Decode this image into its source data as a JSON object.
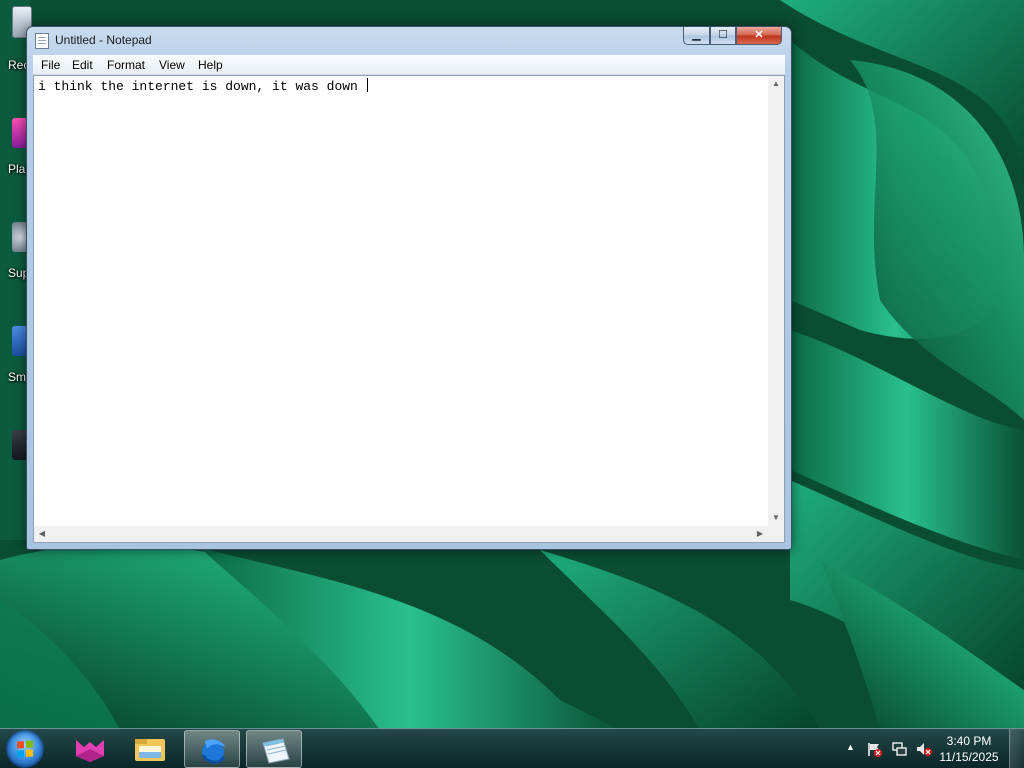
{
  "desktop": {
    "icons": [
      {
        "label": "Rec",
        "icon": "recycle-bin-icon"
      },
      {
        "label": "Pla",
        "icon": "shortcut-icon"
      },
      {
        "label": "Sup",
        "icon": "shortcut-icon"
      },
      {
        "label": "Sm",
        "icon": "shortcut-icon"
      },
      {
        "label": "",
        "icon": "shortcut-icon"
      }
    ]
  },
  "window": {
    "title": "Untitled - Notepad",
    "controls": {
      "minimize": "▁",
      "maximize": "☐",
      "close": "✕"
    },
    "menu": [
      "File",
      "Edit",
      "Format",
      "View",
      "Help"
    ],
    "content": "i think the internet is down, it was down "
  },
  "taskbar": {
    "buttons": [
      {
        "name": "pinned-app-icon",
        "active": false
      },
      {
        "name": "file-explorer-icon",
        "active": false
      },
      {
        "name": "browser-icon",
        "active": true
      },
      {
        "name": "notepad-icon",
        "active": true
      }
    ],
    "tray": {
      "show_hidden": "▲",
      "icons": [
        "action-center-flag-icon",
        "network-icon",
        "volume-muted-icon"
      ]
    },
    "clock": {
      "time": "3:40 PM",
      "date": "11/15/2025"
    }
  },
  "colors": {
    "accent": "#3a8de0",
    "wallpaper": "#0b5a3c",
    "close_button": "#c0321c"
  }
}
